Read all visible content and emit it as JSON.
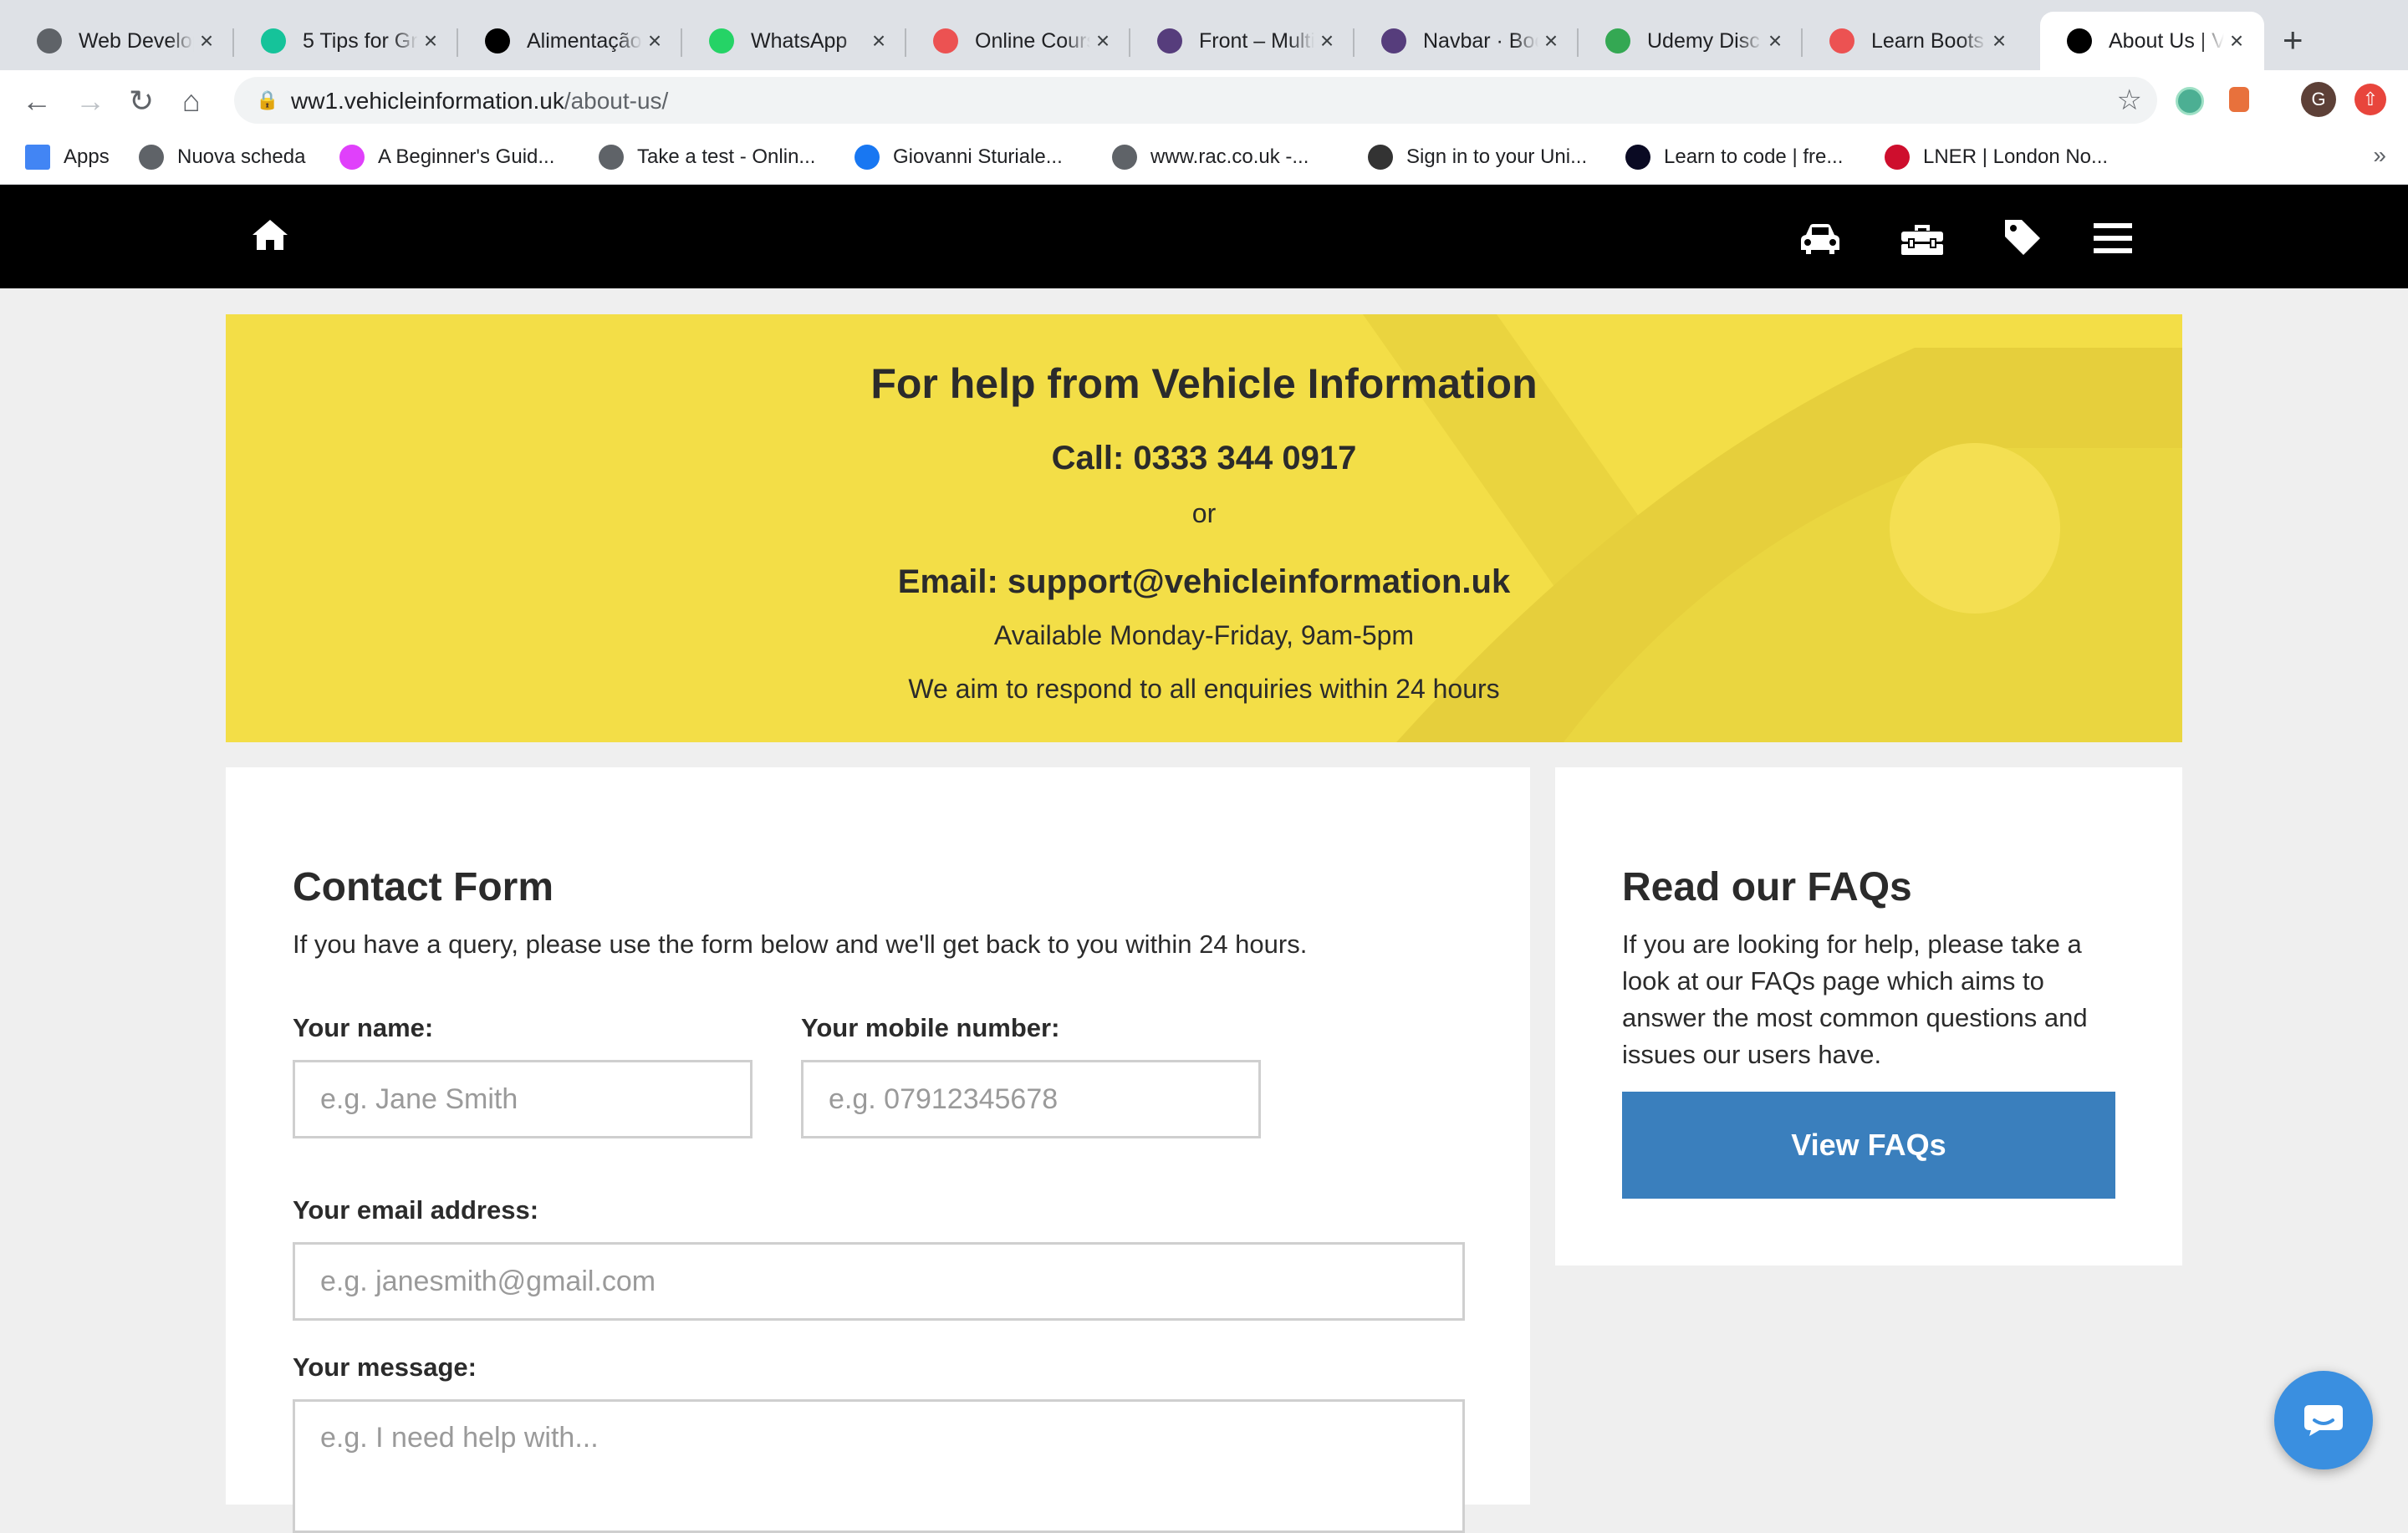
{
  "browser": {
    "tabs": [
      {
        "title": "Web Developer",
        "favicon": "globe-icon",
        "color": "#5f6368"
      },
      {
        "title": "5 Tips for Gr",
        "favicon": "grammarly-icon",
        "color": "#15c39a"
      },
      {
        "title": "Alimentação",
        "favicon": "wix-icon",
        "color": "#000000"
      },
      {
        "title": "WhatsApp",
        "favicon": "whatsapp-icon",
        "color": "#25d366"
      },
      {
        "title": "Online Cours",
        "favicon": "udemy-icon",
        "color": "#ec5252"
      },
      {
        "title": "Front – Multi",
        "favicon": "bootstrap-icon",
        "color": "#563d7c"
      },
      {
        "title": "Navbar · Boo",
        "favicon": "bootstrap-icon",
        "color": "#563d7c"
      },
      {
        "title": "Udemy Disc",
        "favicon": "gpartner-icon",
        "color": "#34a853"
      },
      {
        "title": "Learn Boots",
        "favicon": "udemy-icon",
        "color": "#ec5252"
      },
      {
        "title": "About Us | V",
        "favicon": "vehicleinfo-icon",
        "color": "#000000"
      }
    ],
    "url_host": "ww1.vehicleinformation.uk",
    "url_path": "/about-us/",
    "profile_initial": "G",
    "bookmarks": [
      {
        "label": "Apps",
        "icon": "apps-grid-icon",
        "color": "#4285f4"
      },
      {
        "label": "Nuova scheda",
        "icon": "globe-icon",
        "color": "#5f6368"
      },
      {
        "label": "A Beginner's Guid...",
        "icon": "bookmark-image-icon",
        "color": "#e040fb"
      },
      {
        "label": "Take a test - Onlin...",
        "icon": "globe-icon",
        "color": "#5f6368"
      },
      {
        "label": "Giovanni Sturiale...",
        "icon": "facebook-icon",
        "color": "#1877f2"
      },
      {
        "label": "www.rac.co.uk -...",
        "icon": "globe-icon",
        "color": "#5f6368"
      },
      {
        "label": "Sign in to your Uni...",
        "icon": "university-crest-icon",
        "color": "#333333"
      },
      {
        "label": "Learn to code | fre...",
        "icon": "freecodecamp-icon",
        "color": "#0a0a23"
      },
      {
        "label": "LNER | London No...",
        "icon": "lner-icon",
        "color": "#ce0e2d"
      }
    ]
  },
  "banner": {
    "title": "For help from Vehicle Information",
    "call": "Call: 0333 344 0917",
    "or": "or",
    "email": "Email: support@vehicleinformation.uk",
    "availability": "Available Monday-Friday, 9am-5pm",
    "response": "We aim to respond to all enquiries within 24 hours",
    "color": "#f3de47"
  },
  "contact": {
    "title": "Contact Form",
    "intro": "If you have a query, please use the form below and we'll get back to you within 24 hours.",
    "name_label": "Your name:",
    "name_placeholder": "e.g. Jane Smith",
    "mobile_label": "Your mobile number:",
    "mobile_placeholder": "e.g. 07912345678",
    "email_label": "Your email address:",
    "email_placeholder": "e.g. janesmith@gmail.com",
    "message_label": "Your message:",
    "message_placeholder": "e.g. I need help with..."
  },
  "faq": {
    "title": "Read our FAQs",
    "text": "If you are looking for help, please take a look at our FAQs page which aims to answer the most common questions and issues our users have.",
    "button": "View FAQs",
    "button_color": "#3a7fbd"
  }
}
